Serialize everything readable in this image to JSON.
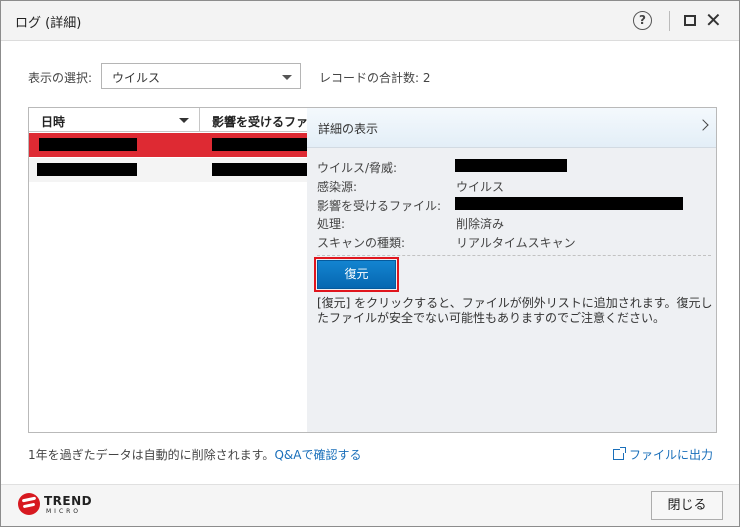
{
  "window": {
    "title": "ログ (詳細)"
  },
  "titlebar": {
    "help_glyph": "?",
    "close_glyph": "✕"
  },
  "filter": {
    "label": "表示の選択:",
    "selected": "ウイルス",
    "record_count": "レコードの合計数: 2"
  },
  "list": {
    "columns": [
      "日時",
      "影響を受けるファイル"
    ],
    "rows": [
      {
        "selected": true,
        "cells": [
          "",
          ""
        ]
      },
      {
        "selected": false,
        "cells": [
          "",
          ""
        ]
      }
    ]
  },
  "detail": {
    "title": "詳細の表示",
    "fields": [
      {
        "label": "ウイルス/脅威:",
        "value": ""
      },
      {
        "label": "感染源:",
        "value": "ウイルス"
      },
      {
        "label": "影響を受けるファイル:",
        "value": ""
      },
      {
        "label": "処理:",
        "value": "削除済み"
      },
      {
        "label": "スキャンの種類:",
        "value": "リアルタイムスキャン"
      }
    ],
    "restore_button": "復元",
    "note": "[復元] をクリックすると、ファイルが例外リストに追加されます。復元したファイルが安全でない可能性もありますのでご注意ください。"
  },
  "footer": {
    "note": "1年を過ぎたデータは自動的に削除されます。",
    "qa_link": "Q&Aで確認する",
    "export_link": "ファイルに出力"
  },
  "brand": {
    "line1": "TREND",
    "line2": "MICRO",
    "color": "#d71920"
  },
  "close_button": "閉じる",
  "colors": {
    "selected_row": "#de2a33",
    "accent_blue": "#0a74c2",
    "link": "#1a6fba"
  }
}
